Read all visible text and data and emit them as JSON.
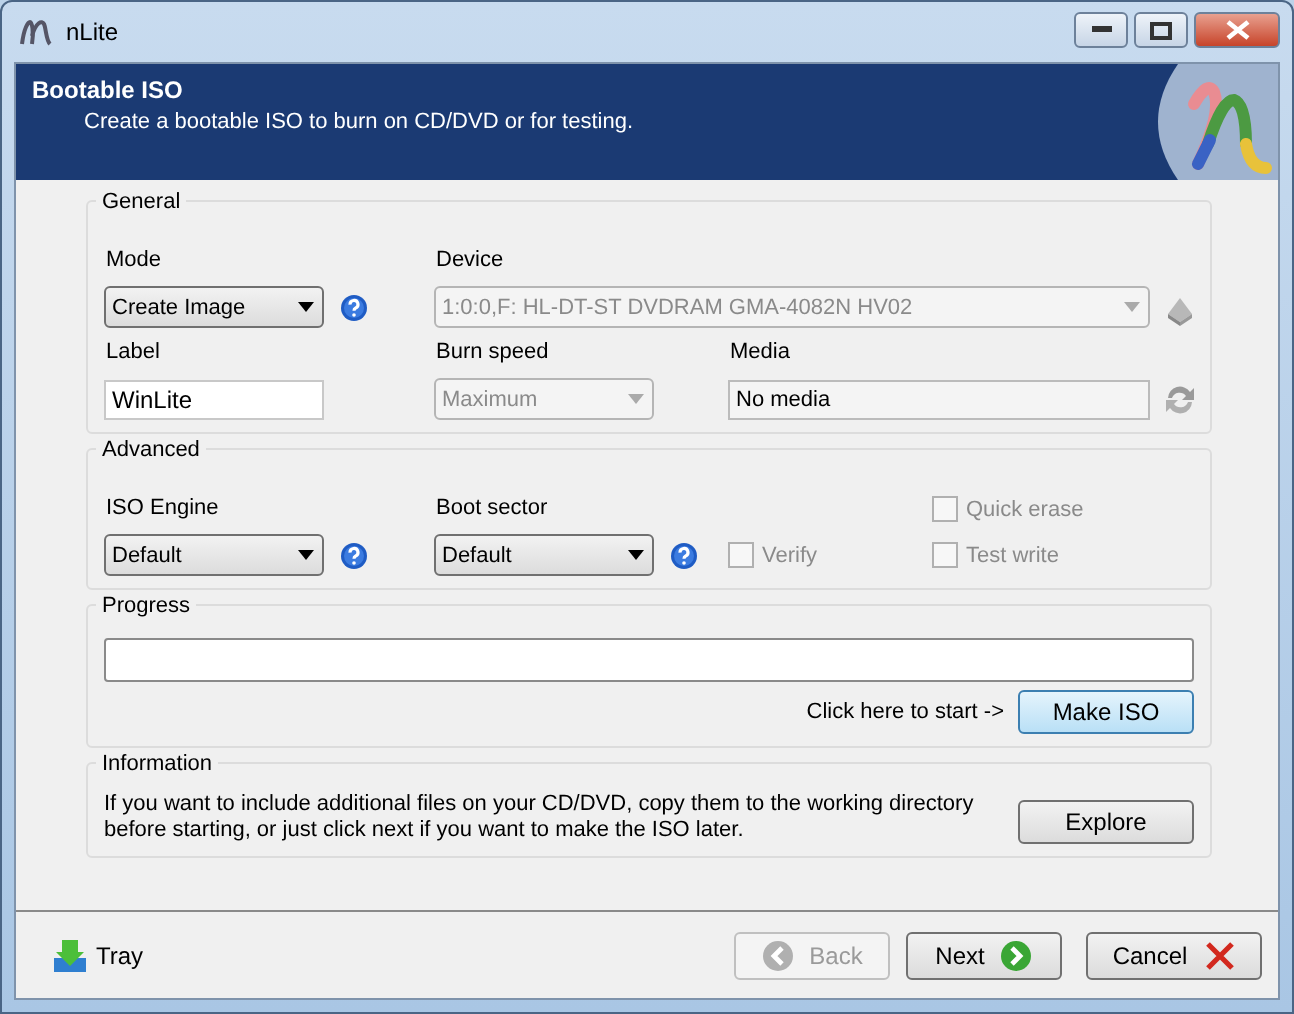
{
  "window": {
    "title": "nLite"
  },
  "header": {
    "title": "Bootable ISO",
    "subtitle": "Create a bootable ISO to burn on CD/DVD or for testing."
  },
  "general": {
    "title": "General",
    "mode": {
      "label": "Mode",
      "value": "Create Image",
      "disabled": false
    },
    "device": {
      "label": "Device",
      "value": "1:0:0,F: HL-DT-ST DVDRAM GMA-4082N HV02",
      "disabled": true
    },
    "label": {
      "label": "Label",
      "value": "WinLite"
    },
    "burn_speed": {
      "label": "Burn speed",
      "value": "Maximum",
      "disabled": true
    },
    "media": {
      "label": "Media",
      "value": "No media"
    }
  },
  "advanced": {
    "title": "Advanced",
    "iso_engine": {
      "label": "ISO Engine",
      "value": "Default",
      "disabled": false
    },
    "boot_sector": {
      "label": "Boot sector",
      "value": "Default",
      "disabled": false
    },
    "checkboxes": [
      {
        "label": "Quick erase",
        "checked": false,
        "disabled": true
      },
      {
        "label": "Verify",
        "checked": false,
        "disabled": true
      },
      {
        "label": "Test write",
        "checked": false,
        "disabled": true
      }
    ]
  },
  "progress": {
    "title": "Progress",
    "level": 0,
    "hint": "Click here to start ->",
    "button": "Make ISO"
  },
  "information": {
    "title": "Information",
    "text": "If you want to include additional files on your CD/DVD, copy them to the working directory before starting, or just click next if you want to make the ISO later.",
    "button": "Explore"
  },
  "footer": {
    "tray": "Tray",
    "buttons": [
      {
        "kind": "back",
        "label": "Back",
        "disabled": true
      },
      {
        "kind": "next",
        "label": "Next",
        "disabled": false
      },
      {
        "kind": "cancel",
        "label": "Cancel",
        "disabled": false
      }
    ]
  }
}
